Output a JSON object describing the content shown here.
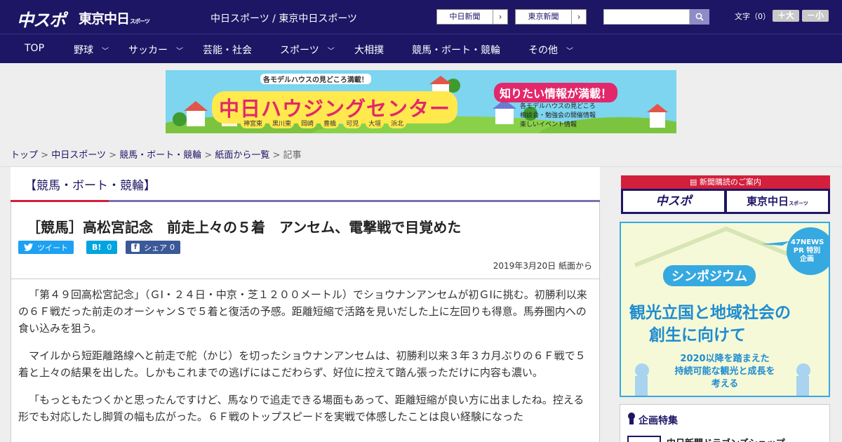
{
  "header": {
    "logo_chuspo": "中スポ",
    "logo_tokyo": "東京中日",
    "logo_tokyo_sub": "スポーツ",
    "site_title": "中日スポーツ / 東京中日スポーツ",
    "ext_links": [
      "中日新聞",
      "東京新聞"
    ],
    "search_placeholder": "",
    "font_label": "文字（0）",
    "font_up": "＋大",
    "font_down": "－小"
  },
  "nav": {
    "items": [
      "TOP",
      "野球",
      "サッカー",
      "芸能・社会",
      "スポーツ",
      "大相撲",
      "競馬・ボート・競輪",
      "その他"
    ]
  },
  "banner": {
    "top_text": "各モデルハウスの見どころ満載！",
    "main_text": "中日ハウジングセンター",
    "side_text": "知りたい情報が満載！",
    "bullets": [
      "各モデルハウスの見どころ",
      "相談会・勉強会の開催情報",
      "楽しいイベント情報"
    ],
    "locations": [
      "神宮東",
      "黒川東",
      "岡崎",
      "豊橋",
      "可児",
      "大垣",
      "浜北"
    ]
  },
  "breadcrumb": {
    "items": [
      "トップ",
      "中日スポーツ",
      "競馬・ボート・競輪",
      "紙面から一覧"
    ],
    "current": "記事",
    "sep": ">"
  },
  "article": {
    "section": "【競馬・ボート・競輪】",
    "headline": "［競馬］高松宮記念　前走上々の５着　アンセム、電撃戦で目覚めた",
    "tweet_label": "ツイート",
    "hatena_label": "B!",
    "hatena_count": "0",
    "fb_label": "シェア",
    "fb_count": "0",
    "date": "2019年3月20日 紙面から",
    "paragraphs": [
      "「第４９回高松宮記念」（ＧⅠ・２４日・中京・芝１２００メートル）でショウナンアンセムが初ＧⅠに挑む。初勝利以来の６Ｆ戦だった前走のオーシャンＳで５着と復活の予感。距離短縮で活路を見いだした上に左回りも得意。馬券圏内への食い込みを狙う。",
      "マイルから短距離路線へと前走で舵（かじ）を切ったショウナンアンセムは、初勝利以来３年３カ月ぶりの６Ｆ戦で５着と上々の結果を出した。しかもこれまでの逃げにはこだわらず、好位に控えて踏ん張っただけに内容も濃い。",
      "「もっともたつくかと思ったんですけど、馬なりで追走できる場面もあって、距離短縮が良い方に出ましたね。控える形でも対応したし脚質の幅も広がった。６Ｆ戦のトップスピードを実戦で体感したことは良い経験になった"
    ]
  },
  "sidebar": {
    "subscribe_title": "新聞購読のご案内",
    "subscribe_chuspo": "中スポ",
    "subscribe_tokyo": "東京中日",
    "subscribe_tokyo_sub": "スポーツ",
    "ad": {
      "badge": "47NEWS PR 特別企画",
      "tag": "シンポジウム",
      "line1": "観光立国と地域社会の",
      "line2": "創生に向けて",
      "sub1": "2020以降を踏まえた",
      "sub2": "持続可能な観光と成長を",
      "sub3": "考える"
    },
    "special_title": "企画特集",
    "special_item": "中日新聞ドラゴンズショップ"
  },
  "colors": {
    "brand_navy": "#1d1665",
    "accent_red": "#d21f3c",
    "twitter": "#1da1f2",
    "hatena": "#00a4de",
    "facebook": "#3b5998"
  }
}
